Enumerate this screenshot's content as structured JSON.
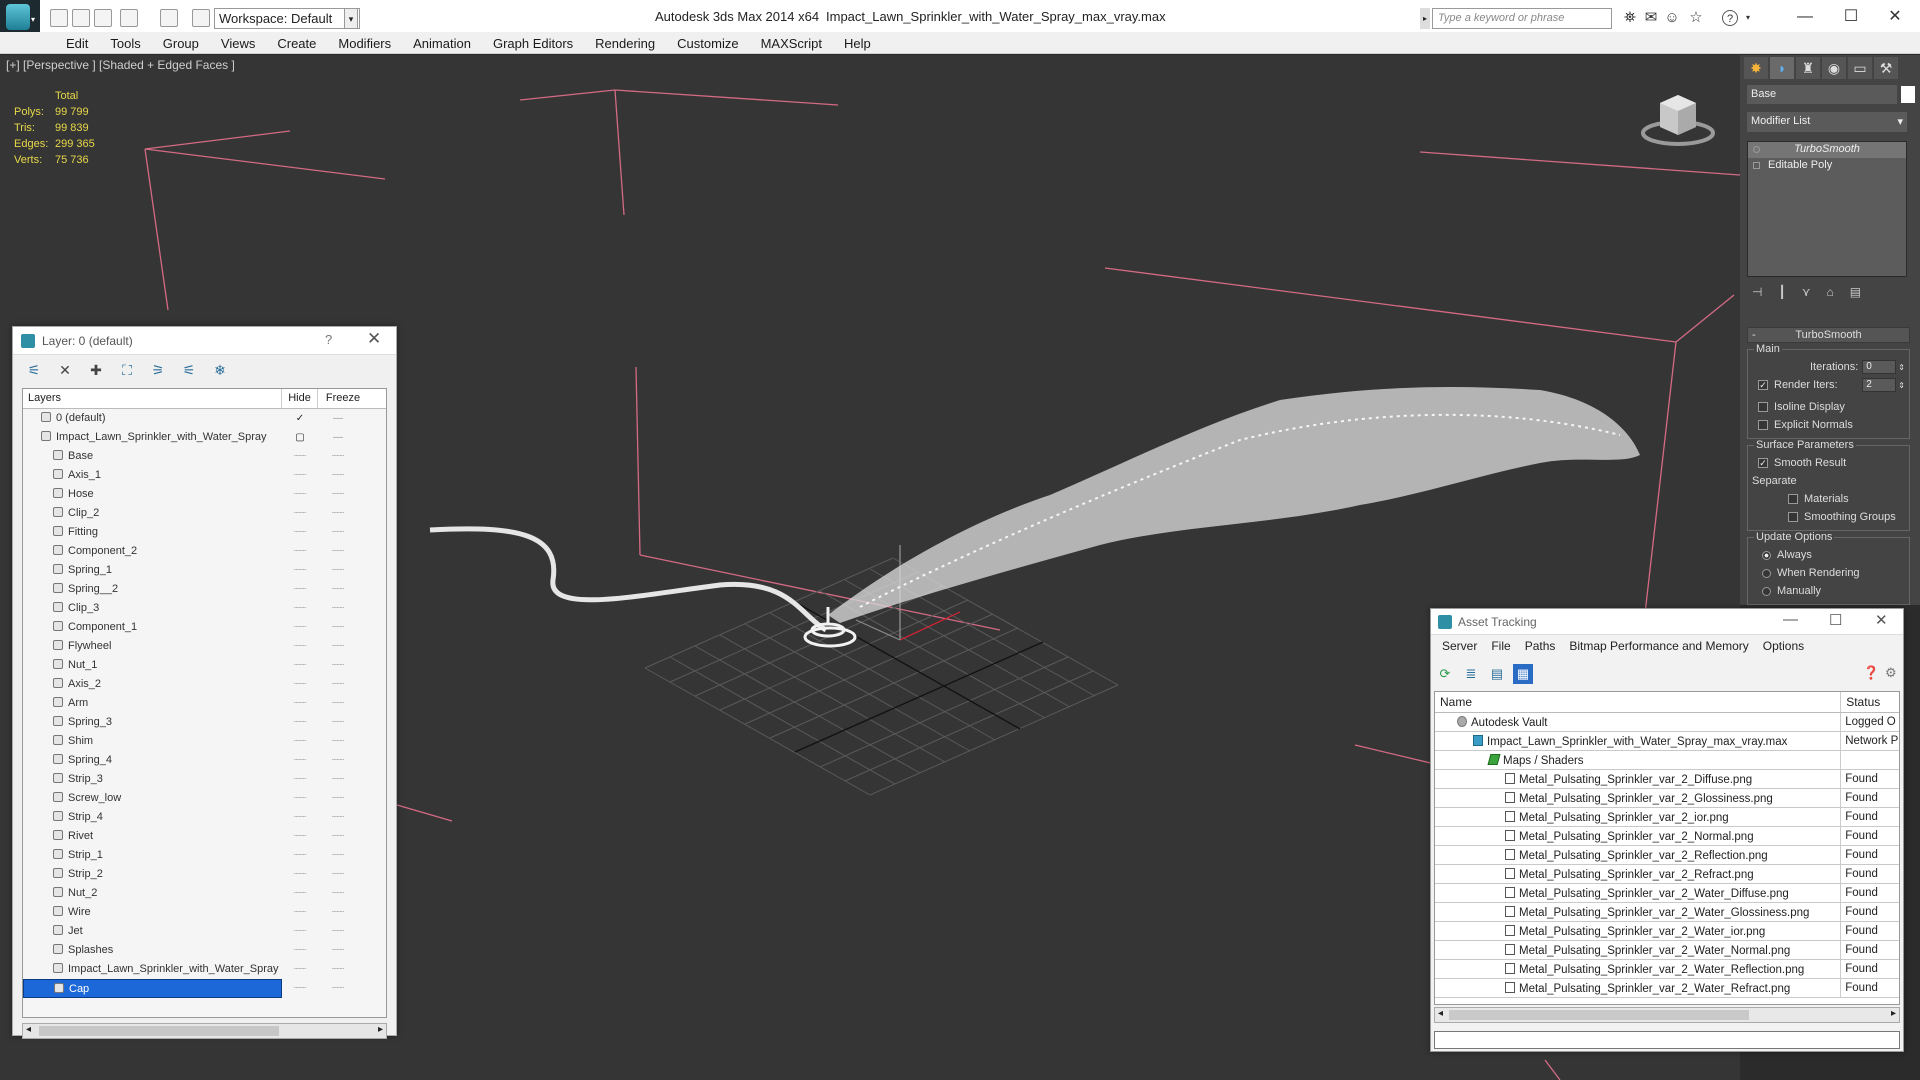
{
  "titlebar": {
    "workspace": "Workspace: Default",
    "app_title": "Autodesk 3ds Max  2014 x64",
    "file_title": "Impact_Lawn_Sprinkler_with_Water_Spray_max_vray.max",
    "search_placeholder": "Type a keyword or phrase",
    "help_icon": "?"
  },
  "menu": [
    "Edit",
    "Tools",
    "Group",
    "Views",
    "Create",
    "Modifiers",
    "Animation",
    "Graph Editors",
    "Rendering",
    "Customize",
    "MAXScript",
    "Help"
  ],
  "viewport": {
    "label": "[+] [Perspective ] [Shaded + Edged Faces ]",
    "stats": {
      "header": "Total",
      "rows": [
        {
          "k": "Polys:",
          "v": "99 799"
        },
        {
          "k": "Tris:",
          "v": "99 839"
        },
        {
          "k": "Edges:",
          "v": "299 365"
        },
        {
          "k": "Verts:",
          "v": "75 736"
        }
      ]
    }
  },
  "layer_panel": {
    "title": "Layer: 0 (default)",
    "help": "?",
    "columns": {
      "layers": "Layers",
      "hide": "Hide",
      "freeze": "Freeze"
    },
    "rows": [
      {
        "name": "0 (default)",
        "level": 0,
        "hide": "✓",
        "freeze": "—"
      },
      {
        "name": "Impact_Lawn_Sprinkler_with_Water_Spray",
        "level": 0,
        "hide": "▢",
        "freeze": "—"
      },
      {
        "name": "Base",
        "level": 1
      },
      {
        "name": "Axis_1",
        "level": 1
      },
      {
        "name": "Hose",
        "level": 1
      },
      {
        "name": "Clip_2",
        "level": 1
      },
      {
        "name": "Fitting",
        "level": 1
      },
      {
        "name": "Component_2",
        "level": 1
      },
      {
        "name": "Spring_1",
        "level": 1
      },
      {
        "name": "Spring__2",
        "level": 1
      },
      {
        "name": "Clip_3",
        "level": 1
      },
      {
        "name": "Component_1",
        "level": 1
      },
      {
        "name": "Flywheel",
        "level": 1
      },
      {
        "name": "Nut_1",
        "level": 1
      },
      {
        "name": "Axis_2",
        "level": 1
      },
      {
        "name": "Arm",
        "level": 1
      },
      {
        "name": "Spring_3",
        "level": 1
      },
      {
        "name": "Shim",
        "level": 1
      },
      {
        "name": "Spring_4",
        "level": 1
      },
      {
        "name": "Strip_3",
        "level": 1
      },
      {
        "name": "Screw_low",
        "level": 1
      },
      {
        "name": "Strip_4",
        "level": 1
      },
      {
        "name": "Rivet",
        "level": 1
      },
      {
        "name": "Strip_1",
        "level": 1
      },
      {
        "name": "Strip_2",
        "level": 1
      },
      {
        "name": "Nut_2",
        "level": 1
      },
      {
        "name": "Wire",
        "level": 1
      },
      {
        "name": "Jet",
        "level": 1
      },
      {
        "name": "Splashes",
        "level": 1
      },
      {
        "name": "Impact_Lawn_Sprinkler_with_Water_Spray",
        "level": 1
      },
      {
        "name": "Cap",
        "level": 1,
        "selected": true
      }
    ]
  },
  "command_panel": {
    "object_name": "Base",
    "modifier_list": "Modifier List",
    "stack": [
      {
        "label": "TurboSmooth",
        "active": true
      },
      {
        "label": "Editable Poly",
        "active": false
      }
    ],
    "rollout_title": "TurboSmooth",
    "main_label": "Main",
    "iterations_label": "Iterations:",
    "iterations_value": "0",
    "render_iters_label": "Render Iters:",
    "render_iters_value": "2",
    "isoline_label": "Isoline Display",
    "explicit_label": "Explicit Normals",
    "surface_label": "Surface Parameters",
    "smooth_result_label": "Smooth Result",
    "separate_label": "Separate",
    "materials_label": "Materials",
    "smoothing_groups_label": "Smoothing Groups",
    "update_label": "Update Options",
    "always_label": "Always",
    "when_rendering_label": "When Rendering",
    "manually_label": "Manually"
  },
  "asset_panel": {
    "title": "Asset Tracking",
    "menu": [
      "Server",
      "File",
      "Paths",
      "Bitmap Performance and Memory",
      "Options"
    ],
    "columns": {
      "name": "Name",
      "status": "Status"
    },
    "rows": [
      {
        "name": "Autodesk Vault",
        "status": "Logged O",
        "indent": 0,
        "icon": "vault"
      },
      {
        "name": "Impact_Lawn_Sprinkler_with_Water_Spray_max_vray.max",
        "status": "Network P",
        "indent": 1,
        "icon": "max"
      },
      {
        "name": "Maps / Shaders",
        "status": "",
        "indent": 2,
        "icon": "maps"
      },
      {
        "name": "Metal_Pulsating_Sprinkler_var_2_Diffuse.png",
        "status": "Found",
        "indent": 3,
        "icon": "file"
      },
      {
        "name": "Metal_Pulsating_Sprinkler_var_2_Glossiness.png",
        "status": "Found",
        "indent": 3,
        "icon": "file"
      },
      {
        "name": "Metal_Pulsating_Sprinkler_var_2_ior.png",
        "status": "Found",
        "indent": 3,
        "icon": "file"
      },
      {
        "name": "Metal_Pulsating_Sprinkler_var_2_Normal.png",
        "status": "Found",
        "indent": 3,
        "icon": "file"
      },
      {
        "name": "Metal_Pulsating_Sprinkler_var_2_Reflection.png",
        "status": "Found",
        "indent": 3,
        "icon": "file"
      },
      {
        "name": "Metal_Pulsating_Sprinkler_var_2_Refract.png",
        "status": "Found",
        "indent": 3,
        "icon": "file"
      },
      {
        "name": "Metal_Pulsating_Sprinkler_var_2_Water_Diffuse.png",
        "status": "Found",
        "indent": 3,
        "icon": "file"
      },
      {
        "name": "Metal_Pulsating_Sprinkler_var_2_Water_Glossiness.png",
        "status": "Found",
        "indent": 3,
        "icon": "file"
      },
      {
        "name": "Metal_Pulsating_Sprinkler_var_2_Water_ior.png",
        "status": "Found",
        "indent": 3,
        "icon": "file"
      },
      {
        "name": "Metal_Pulsating_Sprinkler_var_2_Water_Normal.png",
        "status": "Found",
        "indent": 3,
        "icon": "file"
      },
      {
        "name": "Metal_Pulsating_Sprinkler_var_2_Water_Reflection.png",
        "status": "Found",
        "indent": 3,
        "icon": "file"
      },
      {
        "name": "Metal_Pulsating_Sprinkler_var_2_Water_Refract.png",
        "status": "Found",
        "indent": 3,
        "icon": "file"
      }
    ]
  },
  "colors": {
    "selection": "#1c68d8",
    "stats_text": "#e8d84a",
    "viewport_bg": "#353535",
    "bbox_lines": "#d46a84"
  }
}
